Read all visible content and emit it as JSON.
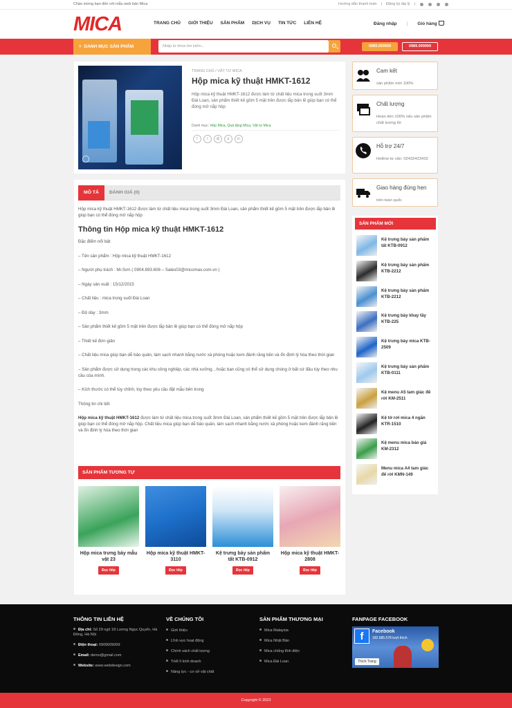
{
  "topbar": {
    "welcome": "Chào mừng bạn đến với mẫu web bán Mica",
    "links": [
      "Hướng dẫn thanh toán",
      "Đăng ký đại lý"
    ]
  },
  "header": {
    "logo": "MICA",
    "nav": [
      "TRANG CHỦ",
      "GIỚI THIỆU",
      "SẢN PHẨM",
      "DỊCH VỤ",
      "TIN TỨC",
      "LIÊN HỆ"
    ],
    "login": "Đăng nhập",
    "cart": "Giỏ hàng"
  },
  "bar": {
    "category": "DANH MỤC SẢN PHẨM",
    "search_placeholder": "Nhập từ khóa tìm kiếm...",
    "phone1": "0989.099999",
    "phone2": "0989.099999"
  },
  "product": {
    "breadcrumb": "TRANG CHỦ  /  VẬT TƯ MICA",
    "title": "Hộp mica kỹ thuật HMKT-1612",
    "desc": "Hộp mica kỹ thuật HMKT-1612 được làm từ chất liệu mica trong suốt 3mm Đài Loan, sản phẩm thiết kế gồm 5 mặt trên được lắp bản lề giúp bạn có thể đóng mở nắp hộp",
    "cat_label": "Danh mục:",
    "cats": "Hộp Mica, Quà tặng Mica, Vật tư Mica"
  },
  "tabs": {
    "desc": "MÔ TẢ",
    "reviews": "ĐÁNH GIÁ (0)"
  },
  "content": {
    "intro": "Hộp mica kỹ thuật HMKT-1612 được làm từ chất liệu mica trong suốt 3mm Đài Loan, sản phẩm thiết kế gồm 5 mặt trên được lắp bản lề giúp bạn có thể đóng mở nắp hộp",
    "heading": "Thông tin Hộp mica kỹ thuật HMKT-1612",
    "lines": [
      "Đặc điểm nổi bật",
      "– Tên sản phẩm : Hộp mica kỹ thuật HMKT-1612",
      "– Người phụ trách : Mr.Sơn ( 0904.893.606 – Sales03@micomax.com.vn )",
      "– Ngày sản xuất : 15/12/2015",
      "– Chất liệu : mica trong suốt Đài Loan",
      "– Độ dày : 3mm",
      "– Sản phẩm thiết kế gồm 5 mặt trên được lắp bản lề giúp bạn có thể đóng mở nắp hộp",
      "– Thiết kế đơn giản",
      "– Chất liệu mica giúp bạn dễ bảo quản, làm sạch nhanh bằng nước xà phòng hoặc kem đánh răng bền và ổn định lý hóa theo thời gian",
      "– Sản phẩm được sử dụng trong các khu công nghiệp, các nhà xưởng…hoặc bạn cũng có thể sử dụng chúng ở bất cứ đâu tùy theo nhu cầu của mình.",
      "– Kích thước có thể tùy chỉnh, tùy theo yêu cầu đặt mẫu bên trong",
      "Thông tin chi tiết"
    ],
    "final_bold": "Hộp mica kỹ thuật HMKT-1612",
    "final_rest": " được làm từ chất liệu mica trong suốt 3mm Đài Loan, sản phẩm thiết kế gồm 5 mặt trên được lắp bản lề giúp bạn có thể đóng mở nắp hộp. Chất liệu mica giúp bạn dễ bảo quản, làm sạch nhanh bằng nước xà phòng hoặc kem đánh răng bền và ổn định lý hóa theo thời gian"
  },
  "related": {
    "heading": "SẢN PHẨM TƯƠNG TỰ",
    "button": "Đọc tiếp",
    "items": [
      {
        "name": "Hộp mica trưng bày mẫu vật 23",
        "color": "#3aa35a"
      },
      {
        "name": "Hộp mica kỹ thuật HMKT-3110",
        "color": "#1d6fc9"
      },
      {
        "name": "Kệ trưng bày sản phẩm tất KTB-0912",
        "color": "#2c8fd6"
      },
      {
        "name": "Hộp mica kỹ thuật HMKT-2808",
        "color": "#e7a7b5"
      }
    ]
  },
  "features": [
    {
      "title": "Cam kết",
      "sub": "sản phẩm mới 100%"
    },
    {
      "title": "Chất lượng",
      "sub": "Hoàn tiền 100% nếu sản phẩm chất lượng tồi"
    },
    {
      "title": "Hỗ trợ 24/7",
      "sub": "Hotline tư vấn: 02432423432"
    },
    {
      "title": "Giao hàng đúng hẹn",
      "sub": "trên toàn quốc"
    }
  ],
  "new_products": {
    "heading": "SẢN PHẨM MỚI",
    "items": [
      {
        "name": "Kệ trưng bày sản phẩm tất KTB-0912",
        "color": "#7fb8e6"
      },
      {
        "name": "Kệ trưng bày sản phẩm KTB-2212",
        "color": "#2b2b2b"
      },
      {
        "name": "Kệ trưng bày sản phẩm KTB-2212",
        "color": "#4a8fd0"
      },
      {
        "name": "Kệ trưng bày khay tầy KTB-225",
        "color": "#3b6fbf"
      },
      {
        "name": "Kệ trưng bày mica KTB-2509",
        "color": "#1f64c8"
      },
      {
        "name": "Kệ trưng bày sản phẩm KTB-0111",
        "color": "#9fc9ee"
      },
      {
        "name": "Kệ menu A5 tam giác đế rời KM-2511",
        "color": "#c9a040"
      },
      {
        "name": "Kệ tờ rơi mica 4 ngăn KTR-1510",
        "color": "#222"
      },
      {
        "name": "Kệ menu mica báo giá KM-2312",
        "color": "#3a9d4a"
      },
      {
        "name": "Menu mica A4 tam giác đế rời KMN-149",
        "color": "#e8d8a8"
      }
    ]
  },
  "footer": {
    "col1": {
      "title": "THÔNG TIN LIÊN HỆ",
      "addr_label": "Địa chỉ:",
      "addr": " Số 29 ngõ 18 Lương Ngọc Quyến, Hà Đông, Hà Nội",
      "phone_label": "Điện thoại:",
      "phone": " 0909009009",
      "email_label": "Email:",
      "email": " demo@gmail.com",
      "web_label": "Website:",
      "web": " www.webdesign.com"
    },
    "col2": {
      "title": "VỀ CHÚNG TÔI",
      "items": [
        "Giới thiệu",
        "Lĩnh vực hoạt động",
        "Chính sách chất lượng",
        "Triết lí kinh doanh",
        "Năng lực - cơ sở vật chất"
      ]
    },
    "col3": {
      "title": "SẢN PHẨM THƯƠNG MẠI",
      "items": [
        "Mica Malaysia",
        "Mica Nhật Bản",
        "Mica chống tĩnh điện",
        "Mica Đài Loan"
      ]
    },
    "col4": {
      "title": "FANPAGE FACEBOOK",
      "fb_name": "Facebook",
      "fb_likes": "182.685.578 lượt thích",
      "fb_like_btn": "Thích Trang"
    },
    "copyright": "Copyright © 2023"
  }
}
